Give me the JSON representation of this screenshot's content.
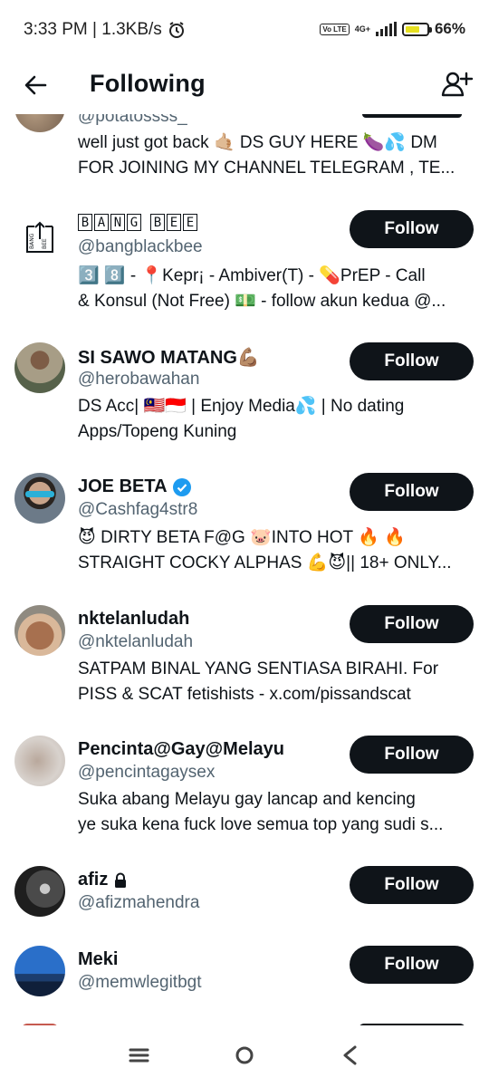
{
  "status_bar": {
    "time_speed": "3:33 PM | 1.3KB/s",
    "network": "4G+",
    "volte": "Vo LTE",
    "battery_level": 0.66,
    "battery_text": "66%"
  },
  "header": {
    "title": "Following",
    "back_icon": "arrow-left-icon",
    "add_icon": "add-user-icon"
  },
  "partial_top": {
    "handle": "@potatossss_",
    "bio_lines": [
      "well just got back 🤙🏼 DS GUY HERE 🍆💦 DM",
      "FOR JOINING MY CHANNEL TELEGRAM , TE..."
    ]
  },
  "users": [
    {
      "name": "BANG BEE",
      "handle": "@bangblackbee",
      "bio_lines": [
        "3️⃣ 8️⃣ - 📍Kepr¡ - Ambiver(T) - 💊PrEP - Call",
        "& Konsul (Not Free) 💵 - follow akun kedua @..."
      ],
      "follow_label": "Follow"
    },
    {
      "name": "SI SAWO MATANG💪🏽",
      "handle": "@herobawahan",
      "bio_lines": [
        "DS Acc| 🇲🇾🇮🇩 | Enjoy Media💦 | No dating",
        "Apps/Topeng Kuning"
      ],
      "follow_label": "Follow"
    },
    {
      "name": "JOE BETA",
      "handle": "@Cashfag4str8",
      "bio_lines": [
        "😈 DIRTY BETA F@G 🐷INTO HOT 🔥 🔥",
        "STRAIGHT COCKY ALPHAS 💪😈|| 18+ ONLY..."
      ],
      "follow_label": "Follow",
      "verified": true
    },
    {
      "name": "nktelanludah",
      "handle": "@nktelanludah",
      "bio_lines": [
        "SATPAM BINAL YANG SENTIASA BIRAHI. For",
        "PISS & SCAT fetishists - x.com/pissandscat"
      ],
      "follow_label": "Follow"
    },
    {
      "name": "Pencinta@Gay@Melayu",
      "handle": "@pencintagaysex",
      "bio_lines": [
        "Suka abang Melayu gay lancap and kencing",
        "ye suka kena fuck love semua top yang sudi s..."
      ],
      "follow_label": "Follow"
    },
    {
      "name": "afiz",
      "handle": "@afizmahendra",
      "bio_lines": [],
      "follow_label": "Follow",
      "protected": true
    },
    {
      "name": "Meki",
      "handle": "@memwlegitbgt",
      "bio_lines": [],
      "follow_label": "Follow"
    }
  ],
  "bangbee_logo_text": "BANG BEE",
  "nav": {
    "recents_icon": "menu-lines-icon",
    "home_icon": "circle-home-icon",
    "back_icon": "chevron-back-icon"
  },
  "colors": {
    "button_bg": "#0f1419",
    "handle": "#536471",
    "verified": "#1d9bf0"
  }
}
